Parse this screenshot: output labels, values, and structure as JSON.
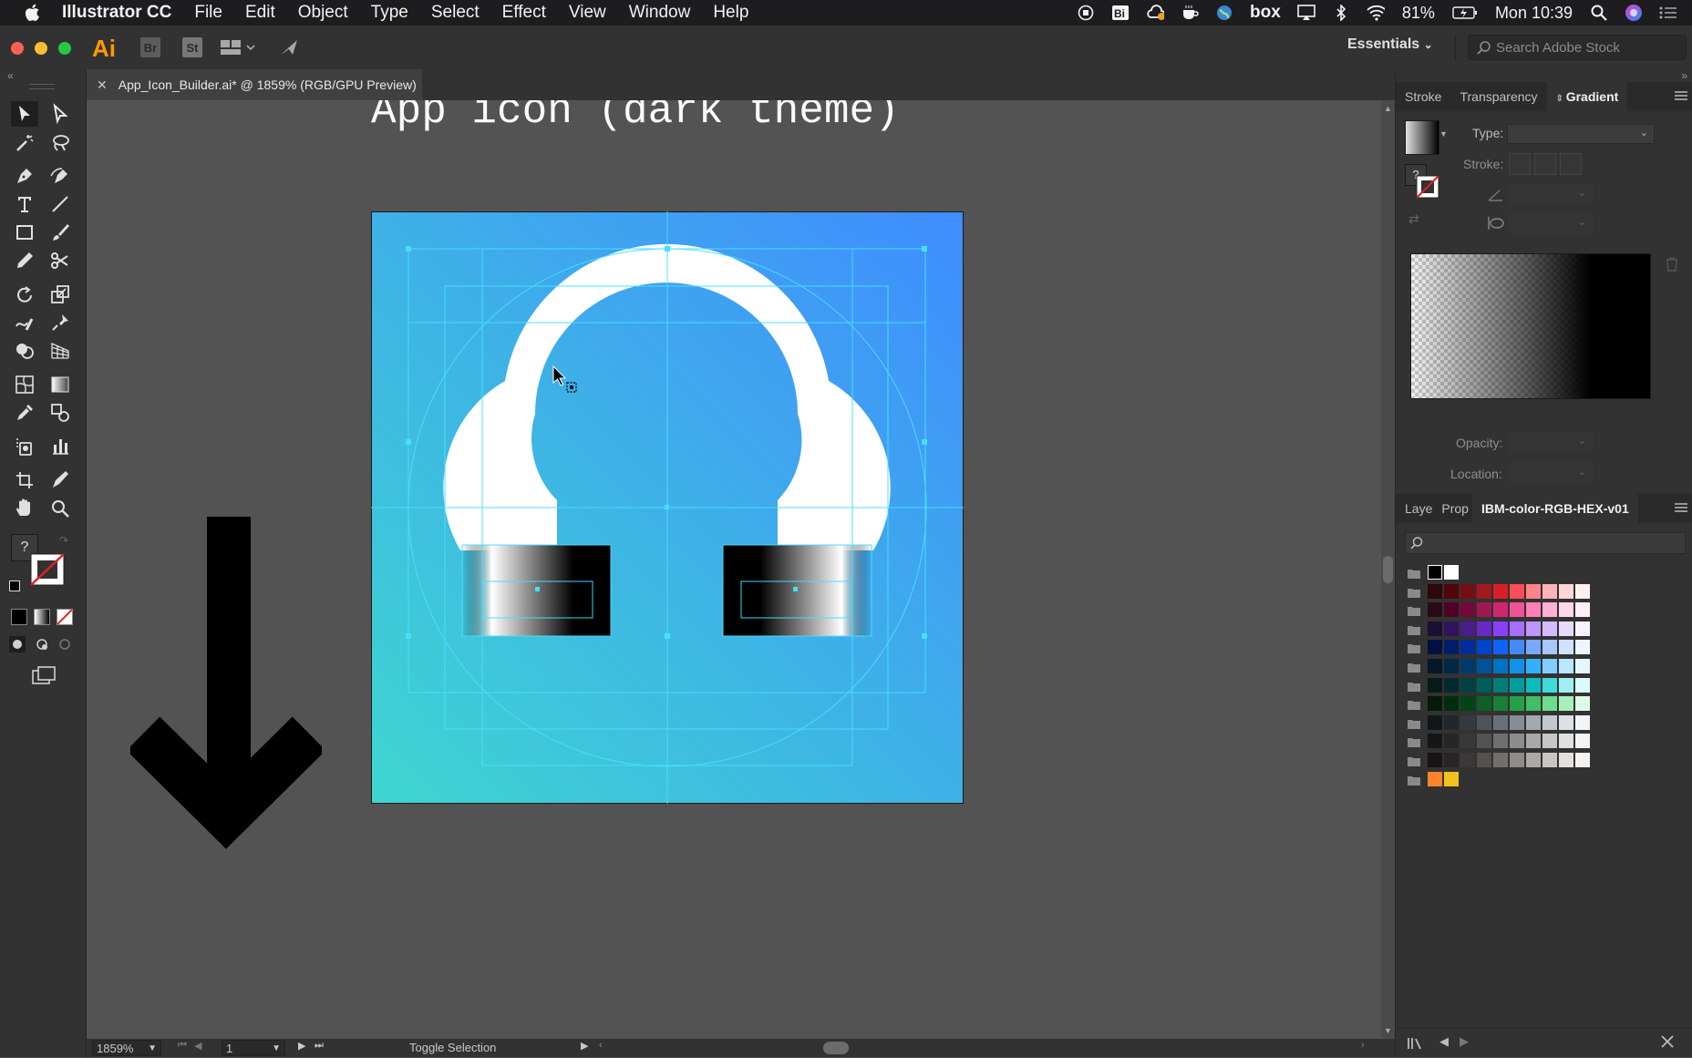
{
  "menubar": {
    "app_name": "Illustrator CC",
    "items": [
      "File",
      "Edit",
      "Object",
      "Type",
      "Select",
      "Effect",
      "View",
      "Window",
      "Help"
    ],
    "battery": "81%",
    "clock": "Mon 10:39",
    "icons": [
      "record-icon",
      "bi-icon",
      "creative-cloud-icon",
      "coffee-cup-icon",
      "globe-icon",
      "box-icon",
      "airplay-icon",
      "bluetooth-icon",
      "wifi-icon",
      "battery-icon",
      "spotlight-icon",
      "siri-icon",
      "notification-center-icon"
    ],
    "box_label": "box"
  },
  "appbar": {
    "logo": "Ai",
    "badges": [
      "Br",
      "St"
    ],
    "workspace": "Essentials",
    "search_placeholder": "Search Adobe Stock"
  },
  "document": {
    "tab_title": "App_Icon_Builder.ai* @ 1859% (RGB/GPU Preview)",
    "heading": "App icon (dark theme)",
    "zoom": "1859%",
    "artboard": "1",
    "status": "Toggle Selection"
  },
  "toolbar": {
    "tools": [
      "selection-tool",
      "direct-selection-tool",
      "magic-wand-tool",
      "lasso-tool",
      "pen-tool",
      "curvature-tool",
      "type-tool",
      "line-tool",
      "rectangle-tool",
      "paintbrush-tool",
      "pencil-tool",
      "scissors-tool",
      "rotate-tool",
      "scale-tool",
      "warp-tool",
      "puppet-warp-tool",
      "shape-builder-tool",
      "perspective-grid-tool",
      "mesh-tool",
      "gradient-tool",
      "eyedropper-tool",
      "blend-tool",
      "symbol-sprayer-tool",
      "column-graph-tool",
      "artboard-tool",
      "slice-tool",
      "hand-tool",
      "zoom-tool"
    ],
    "fill_label": "?"
  },
  "gradient_panel": {
    "tabs": [
      "Stroke",
      "Transparency",
      "Gradient"
    ],
    "active_tab": "Gradient",
    "type_label": "Type:",
    "stroke_label": "Stroke:",
    "opacity_label": "Opacity:",
    "location_label": "Location:",
    "swatch_label": "?"
  },
  "swatches_panel": {
    "tabs": [
      "Laye",
      "Prop",
      "IBM-color-RGB-HEX-v01"
    ],
    "active_tab": "IBM-color-RGB-HEX-v01",
    "rows": [
      [
        "#000000",
        "#ffffff"
      ],
      [
        "#2d0709",
        "#520408",
        "#750e13",
        "#a2191f",
        "#da1e28",
        "#fa4d56",
        "#ff8389",
        "#ffb3b8",
        "#ffd7d9",
        "#fff1f1"
      ],
      [
        "#2a0a18",
        "#510224",
        "#740937",
        "#9f1853",
        "#d02670",
        "#ee5396",
        "#ff7eb6",
        "#ffafd2",
        "#ffd6e8",
        "#fff0f7"
      ],
      [
        "#1c0f30",
        "#31135e",
        "#491d8b",
        "#6929c4",
        "#8a3ffc",
        "#a56eff",
        "#be95ff",
        "#d4bbff",
        "#e8daff",
        "#f6f2ff"
      ],
      [
        "#001141",
        "#001d6c",
        "#002d9c",
        "#0043ce",
        "#0f62fe",
        "#4589ff",
        "#78a9ff",
        "#a6c8ff",
        "#d0e2ff",
        "#edf5ff"
      ],
      [
        "#061727",
        "#012749",
        "#003a6d",
        "#00539a",
        "#0072c3",
        "#1192e8",
        "#33b1ff",
        "#82cfff",
        "#bae6ff",
        "#e5f6ff"
      ],
      [
        "#081a1c",
        "#022b30",
        "#004144",
        "#005d5d",
        "#007d79",
        "#009d9a",
        "#08bdba",
        "#3ddbd9",
        "#9ef0f0",
        "#d9fbfb"
      ],
      [
        "#071908",
        "#022d0d",
        "#044317",
        "#0e6027",
        "#198038",
        "#24a148",
        "#42be65",
        "#6fdc8c",
        "#a7f0ba",
        "#defbe6"
      ],
      [
        "#121619",
        "#21272a",
        "#343a3f",
        "#4d5358",
        "#697077",
        "#878d96",
        "#a2a9b0",
        "#c1c7cd",
        "#dde1e6",
        "#f2f4f8"
      ],
      [
        "#161616",
        "#262626",
        "#393939",
        "#525252",
        "#6f6f6f",
        "#8d8d8d",
        "#a8a8a8",
        "#c6c6c6",
        "#e0e0e0",
        "#f4f4f4"
      ],
      [
        "#171414",
        "#272525",
        "#3c3838",
        "#565151",
        "#726e6e",
        "#8f8b8b",
        "#ada8a8",
        "#cac5c4",
        "#e5e0df",
        "#f7f3f2"
      ],
      [
        "#ff832b",
        "#f1c21b"
      ]
    ]
  },
  "colors": {
    "gradient_start": "#3ed6d0",
    "gradient_end": "#3f8cff",
    "guides": "#46e0ff",
    "accent": "#ff9a00"
  }
}
